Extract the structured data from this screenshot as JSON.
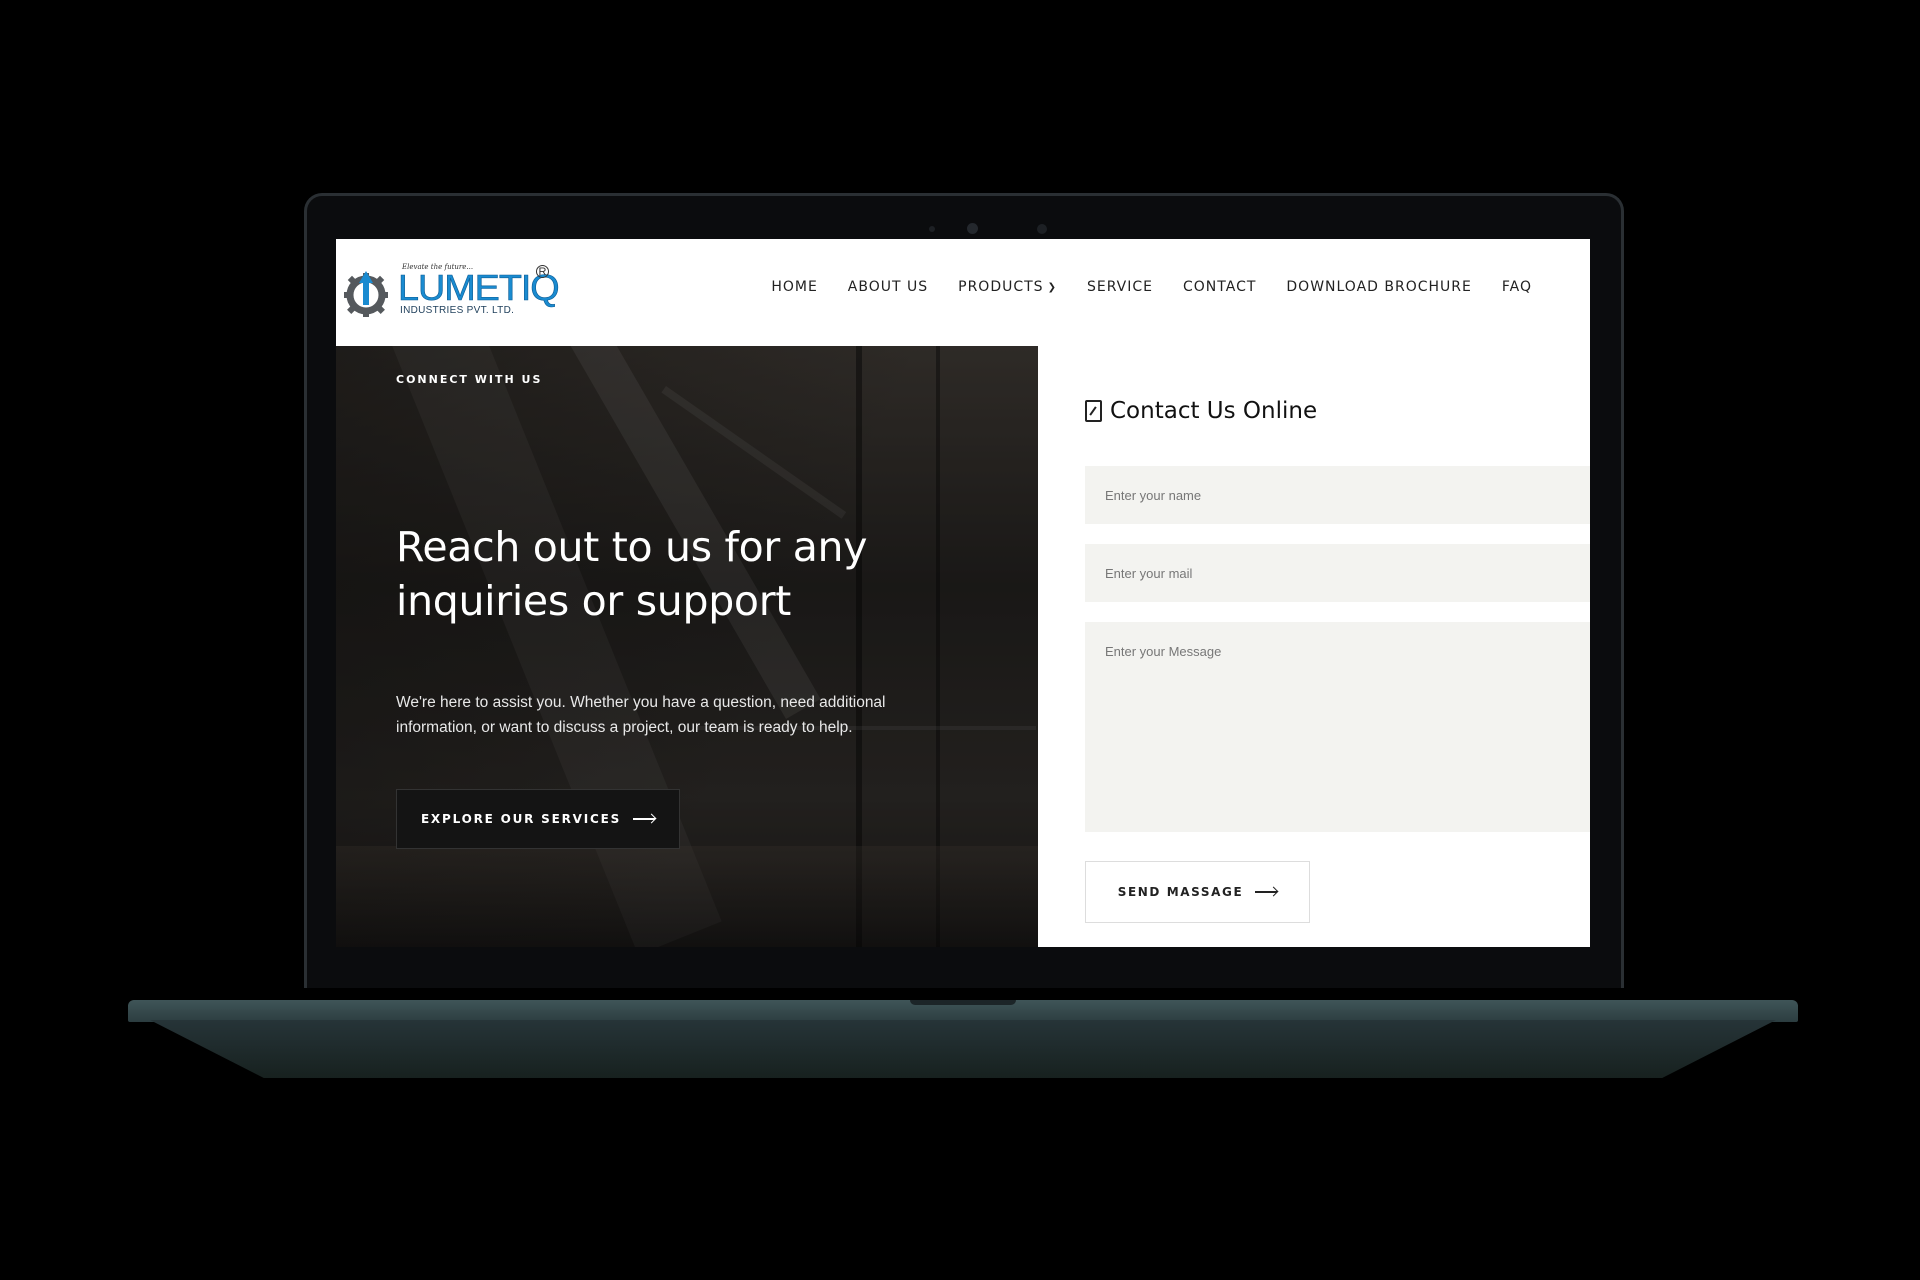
{
  "brand": {
    "tagline": "Elevate the future...",
    "name": "LUMETIQ",
    "registered": "R",
    "subtitle": "INDUSTRIES PVT. LTD."
  },
  "nav": {
    "items": [
      {
        "label": "HOME"
      },
      {
        "label": "ABOUT US"
      },
      {
        "label": "PRODUCTS",
        "has_dropdown": true
      },
      {
        "label": "SERVICE"
      },
      {
        "label": "CONTACT"
      },
      {
        "label": "DOWNLOAD BROCHURE"
      },
      {
        "label": "FAQ"
      }
    ]
  },
  "hero": {
    "eyebrow": "CONNECT WITH US",
    "title": "Reach out to us for any inquiries or support",
    "description": "We're here to assist you. Whether you have a question, need additional information, or want to discuss a project, our team is ready to help.",
    "button_label": "EXPLORE OUR SERVICES"
  },
  "contact": {
    "heading": "Contact Us Online",
    "name_placeholder": "Enter your name",
    "mail_placeholder": "Enter your mail",
    "message_placeholder": "Enter your Message",
    "submit_label": "SEND MASSAGE"
  },
  "colors": {
    "brand_blue": "#1a8bd0",
    "field_bg": "#f3f3f0",
    "hero_button_bg": "#141414"
  },
  "icons": [
    "gear-logo-icon",
    "chevron-down-icon",
    "arrow-right-icon",
    "document-edit-icon",
    "webcam-icon"
  ]
}
